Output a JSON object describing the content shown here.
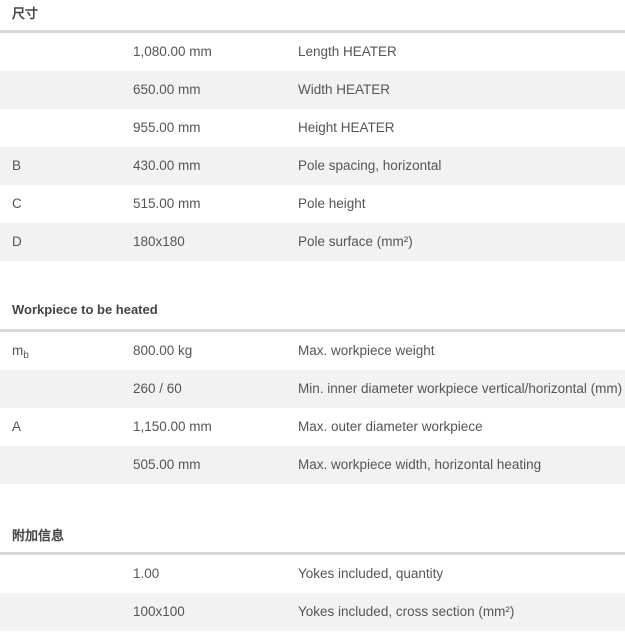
{
  "sections": [
    {
      "title": "尺寸",
      "rows": [
        {
          "symbol": "",
          "value": "1,080.00 mm",
          "desc": "Length HEATER"
        },
        {
          "symbol": "",
          "value": "650.00 mm",
          "desc": "Width HEATER"
        },
        {
          "symbol": "",
          "value": "955.00 mm",
          "desc": "Height HEATER"
        },
        {
          "symbol": "B",
          "value": "430.00 mm",
          "desc": "Pole spacing, horizontal"
        },
        {
          "symbol": "C",
          "value": "515.00 mm",
          "desc": "Pole height"
        },
        {
          "symbol": "D",
          "value": "180x180",
          "desc": "Pole surface (mm²)"
        }
      ]
    },
    {
      "title": "Workpiece to be heated",
      "rows": [
        {
          "symbol": "m",
          "symbol_sub": "b",
          "value": "800.00 kg",
          "desc": "Max. workpiece weight"
        },
        {
          "symbol": "",
          "value": "260 / 60",
          "desc": "Min. inner diameter workpiece vertical/horizontal (mm)"
        },
        {
          "symbol": "A",
          "value": "1,150.00 mm",
          "desc": "Max. outer diameter workpiece"
        },
        {
          "symbol": "",
          "value": "505.00 mm",
          "desc": "Max. workpiece width, horizontal heating"
        }
      ]
    },
    {
      "title": "附加信息",
      "rows": [
        {
          "symbol": "",
          "value": "1.00",
          "desc": "Yokes included, quantity"
        },
        {
          "symbol": "",
          "value": "100x100",
          "desc": "Yokes included, cross section (mm²)"
        }
      ]
    }
  ]
}
